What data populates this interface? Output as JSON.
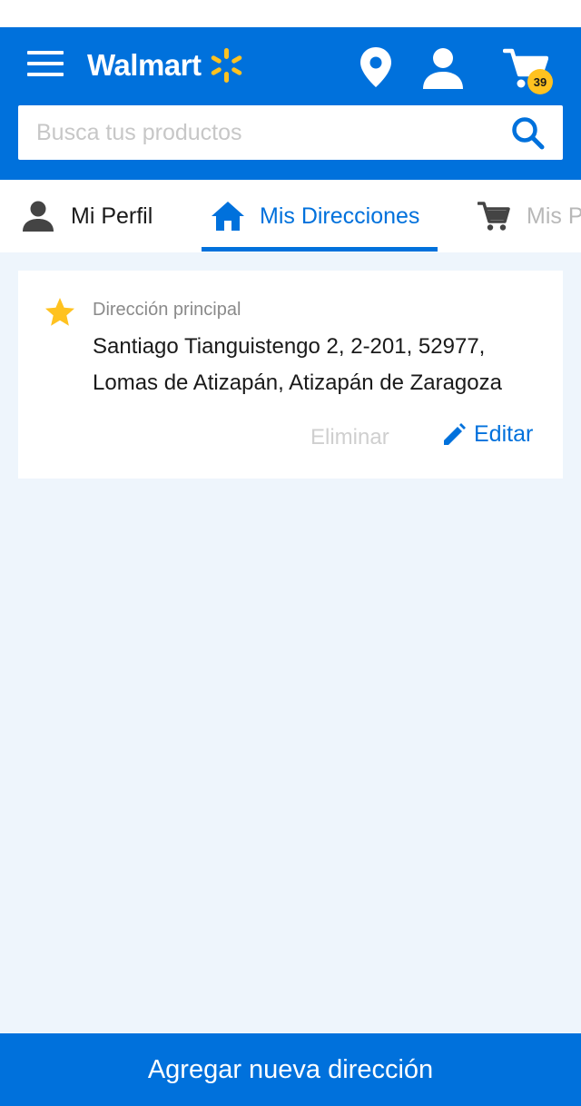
{
  "header": {
    "brand": "Walmart",
    "cart_count": "39",
    "search_placeholder": "Busca tus productos"
  },
  "tabs": [
    {
      "label": "Mi Perfil",
      "icon": "person-icon"
    },
    {
      "label": "Mis Direcciones",
      "icon": "home-icon",
      "active": true
    },
    {
      "label": "Mis P",
      "icon": "cart-icon"
    }
  ],
  "address_card": {
    "label": "Dirección principal",
    "line1": "Santiago Tianguistengo 2, 2-201, 52977,",
    "line2": "Lomas de Atizapán, Atizapán de Zaragoza",
    "delete_label": "Eliminar",
    "edit_label": "Editar"
  },
  "add_button_label": "Agregar nueva dirección",
  "colors": {
    "primary": "#0071dc",
    "accent": "#ffc220",
    "background": "#eef5fc"
  }
}
